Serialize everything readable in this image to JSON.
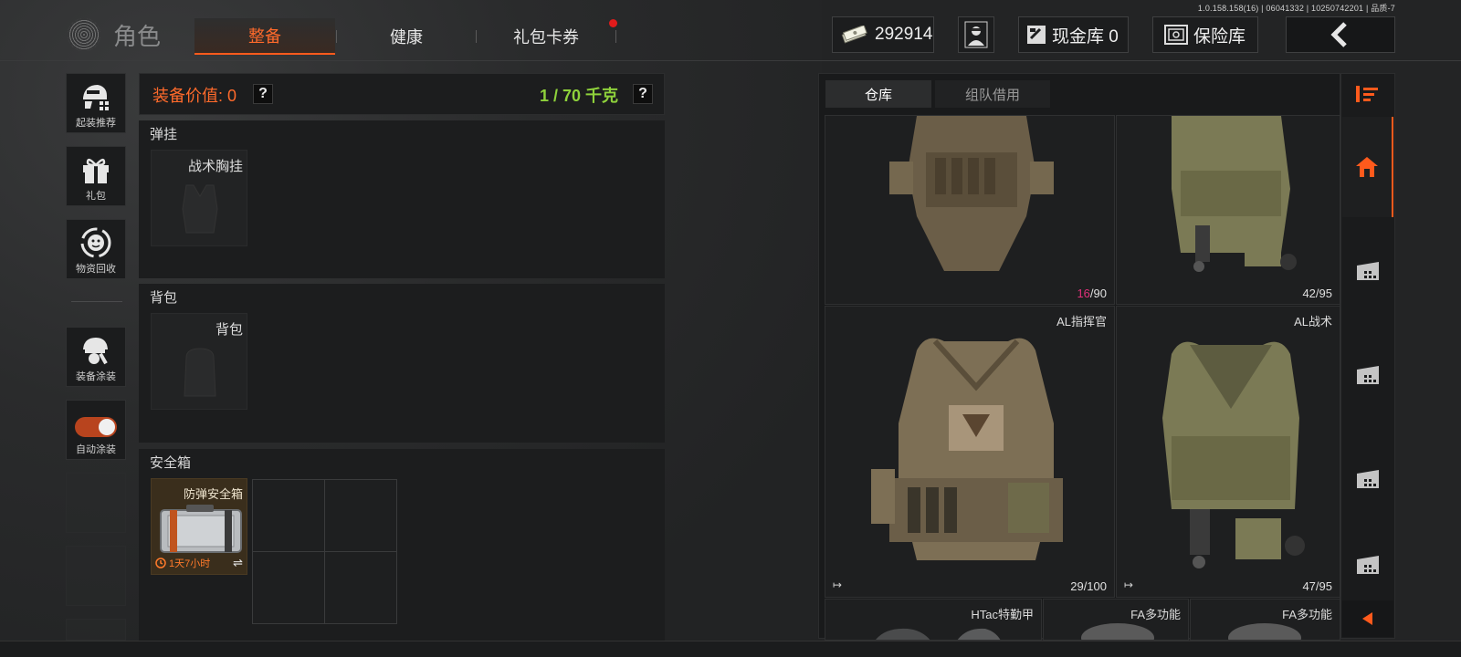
{
  "version": "1.0.158.158(16) | 06041332 | 10250742201 | 品质-7",
  "header": {
    "page_title": "角色",
    "tabs": [
      {
        "label": "整备",
        "active": true
      },
      {
        "label": "健康",
        "active": false
      },
      {
        "label": "礼包卡券",
        "active": false,
        "badge": true
      }
    ],
    "currency_amount": "292914",
    "cash_vault_label": "现金库 0",
    "safe_vault_label": "保险库",
    "back_icon": "chevron-left-icon"
  },
  "left_menu": [
    {
      "label": "起装推荐",
      "icon": "helmet-gear-icon"
    },
    {
      "label": "礼包",
      "icon": "gift-icon"
    },
    {
      "label": "物资回收",
      "icon": "recycle-icon"
    },
    {
      "label": "装备涂装",
      "icon": "helmet-paint-icon"
    },
    {
      "label": "自动涂装",
      "icon": "toggle-icon",
      "toggle_on": true
    }
  ],
  "equipment": {
    "value_label": "装备价值: 0",
    "weight_label": "1 / 70 千克",
    "sections": [
      {
        "title": "弹挂",
        "slot_label": "战术胸挂"
      },
      {
        "title": "背包",
        "slot_label": "背包"
      },
      {
        "title": "安全箱",
        "slot_label": "防弹安全箱",
        "timer": "1天7小时"
      }
    ]
  },
  "inventory": {
    "tabs": [
      {
        "label": "仓库",
        "active": true
      },
      {
        "label": "组队借用",
        "active": false
      }
    ],
    "items": [
      {
        "name": "",
        "dur_current": "16",
        "dur_max": "/90",
        "dur_low": true,
        "color": "#6b5e48"
      },
      {
        "name": "",
        "dur_current": "42/95",
        "dur_max": "",
        "dur_low": false,
        "color": "#7b7a55"
      },
      {
        "name": "AL指挥官",
        "dur_current": "29/100",
        "dur_max": "",
        "dur_low": false,
        "color": "#7d6f55",
        "exit_icon": "↦"
      },
      {
        "name": "AL战术",
        "dur_current": "47/95",
        "dur_max": "",
        "dur_low": false,
        "color": "#7b7a55",
        "exit_icon": "↦"
      },
      {
        "name": "HTac特勤甲",
        "dur_current": "",
        "color": "#4a4b4c"
      },
      {
        "name": "FA多功能",
        "dur_current": "",
        "color": "#5a5a5a"
      },
      {
        "name": "FA多功能",
        "dur_current": "",
        "color": "#5a5a5a"
      }
    ]
  },
  "colors": {
    "accent_orange": "#ff5a1c",
    "weight_green": "#8ed13b",
    "durability_low": "#e0307a"
  }
}
